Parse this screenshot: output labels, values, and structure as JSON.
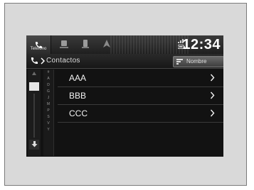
{
  "status_bar": {
    "phone_tab_label": "Teléfono",
    "clock": "12:34"
  },
  "header": {
    "title": "Contactos",
    "button_label": "Nombre"
  },
  "index_letters": [
    "#",
    "A",
    "D",
    "G",
    "J",
    "M",
    "P",
    "S",
    "V",
    "Y"
  ],
  "contacts": [
    {
      "name": "AAA"
    },
    {
      "name": "BBB"
    },
    {
      "name": "CCC"
    }
  ]
}
